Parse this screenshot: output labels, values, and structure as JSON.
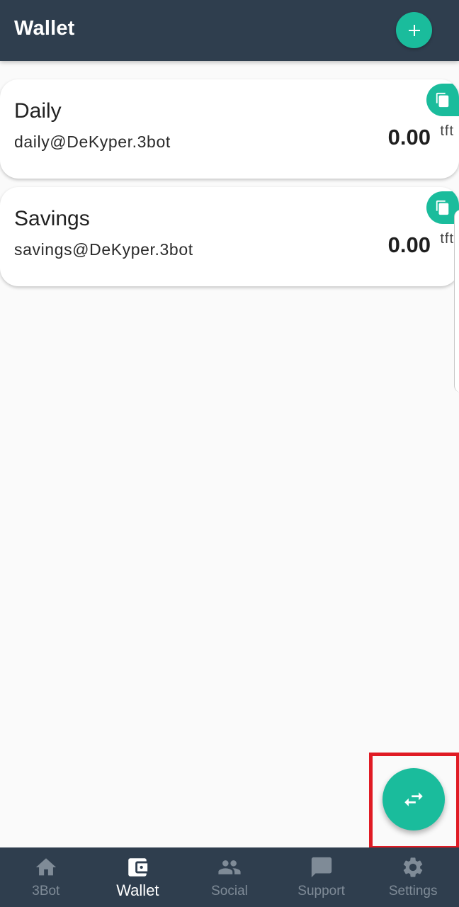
{
  "header": {
    "title": "Wallet"
  },
  "wallets": [
    {
      "name": "Daily",
      "address": "daily@DeKyper.3bot",
      "amount": "0.00",
      "unit": "tft"
    },
    {
      "name": "Savings",
      "address": "savings@DeKyper.3bot",
      "amount": "0.00",
      "unit": "tft"
    }
  ],
  "nav": {
    "items": [
      {
        "label": "3Bot",
        "icon": "home-icon"
      },
      {
        "label": "Wallet",
        "icon": "wallet-icon"
      },
      {
        "label": "Social",
        "icon": "people-icon"
      },
      {
        "label": "Support",
        "icon": "chat-icon"
      },
      {
        "label": "Settings",
        "icon": "gear-icon"
      }
    ],
    "active_index": 1
  },
  "colors": {
    "header_bg": "#2f3e4e",
    "accent": "#1abc9c",
    "highlight": "#e01b24",
    "nav_inactive": "#7f8b97",
    "nav_active": "#ffffff"
  },
  "icons": {
    "add": "plus-icon",
    "copy": "copy-icon",
    "transfer": "swap-arrows-icon"
  }
}
